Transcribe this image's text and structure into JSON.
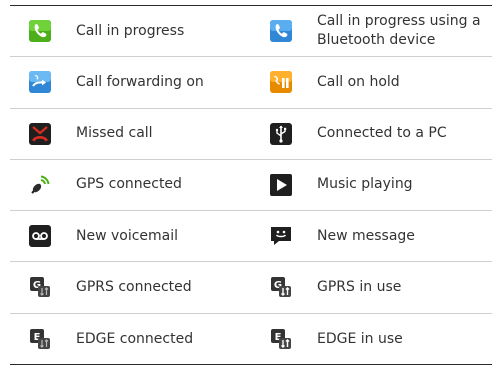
{
  "rows": [
    {
      "left": {
        "label": "Call in progress",
        "icon": "call-in-progress-icon"
      },
      "right": {
        "label": "Call in progress using a Bluetooth device",
        "icon": "bluetooth-call-icon"
      }
    },
    {
      "left": {
        "label": "Call forwarding on",
        "icon": "call-forwarding-icon"
      },
      "right": {
        "label": "Call on hold",
        "icon": "call-on-hold-icon"
      }
    },
    {
      "left": {
        "label": "Missed call",
        "icon": "missed-call-icon"
      },
      "right": {
        "label": "Connected to a PC",
        "icon": "usb-icon"
      }
    },
    {
      "left": {
        "label": "GPS connected",
        "icon": "gps-icon"
      },
      "right": {
        "label": "Music playing",
        "icon": "play-icon"
      }
    },
    {
      "left": {
        "label": "New voicemail",
        "icon": "voicemail-icon"
      },
      "right": {
        "label": "New message",
        "icon": "message-icon"
      }
    },
    {
      "left": {
        "label": "GPRS connected",
        "icon": "gprs-connected-icon"
      },
      "right": {
        "label": "GPRS in use",
        "icon": "gprs-in-use-icon"
      }
    },
    {
      "left": {
        "label": "EDGE connected",
        "icon": "edge-connected-icon"
      },
      "right": {
        "label": "EDGE in use",
        "icon": "edge-in-use-icon"
      }
    }
  ],
  "colors": {
    "green": "#4caf1a",
    "blue": "#2f87d6",
    "orange": "#e88a00",
    "red": "#d62d20",
    "dark": "#1f1f1f"
  }
}
